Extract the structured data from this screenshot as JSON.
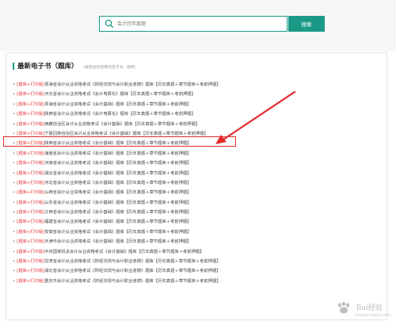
{
  "search": {
    "placeholder": "会计历年真题",
    "button_label": "搜索"
  },
  "section": {
    "title": "最新电子书（题库）",
    "hint": "（搜索查找您要的电子书、题库）"
  },
  "bullet": "•",
  "items": [
    {
      "tag": "[题库+打印版]",
      "name": "青海省会计从业资格考试《财经法规与会计职业道德》题库【历年真题＋章节题库＋考前押题】"
    },
    {
      "tag": "[题库+打印版]",
      "name": "河北省会计从业资格考试《会计电算化》题库【历年真题＋章节题库＋考前押题】"
    },
    {
      "tag": "[题库+打印版]",
      "name": "青海省会计从业资格考试《会计基础》题库【历年真题＋章节题库＋考前押题】"
    },
    {
      "tag": "[题库+打印版]",
      "name": "陕西省会计从业资格考试《会计电算化》题库【历年真题＋章节题库＋考前押题】"
    },
    {
      "tag": "[题库+打印版]",
      "name": "西藏自治区会计从业资格考试《会计基础》题库【历年真题＋章节题库＋考前押题】"
    },
    {
      "tag": "[题库+打印版]",
      "name": "宁夏回族自治区会计从业资格考试《会计基础》题库【历年真题＋章节题库＋考前押题】"
    },
    {
      "tag": "[题库+打印版]",
      "name": "陕西省会计从业资格考试《会计基础》题库【历年真题＋章节题库＋考前押题】"
    },
    {
      "tag": "[题库+打印版]",
      "name": "海南省会计从业资格考试《会计基础》题库【历年真题＋章节题库＋考前押题】"
    },
    {
      "tag": "[题库+打印版]",
      "name": "河南省会计从业资格考试《会计基础》题库【历年真题＋章节题库＋考前押题】"
    },
    {
      "tag": "[题库+打印版]",
      "name": "湖北省会计从业资格考试《会计基础》题库【历年真题＋章节题库＋考前押题】"
    },
    {
      "tag": "[题库+打印版]",
      "name": "河北省会计从业资格考试《会计基础》题库【历年真题＋章节题库＋考前押题】"
    },
    {
      "tag": "[题库+打印版]",
      "name": "山西省会计从业资格考试《会计基础》题库【历年真题＋章节题库＋考前押题】"
    },
    {
      "tag": "[题库+打印版]",
      "name": "山东省会计从业资格考试《会计基础》题库【历年真题＋章节题库＋考前押题】"
    },
    {
      "tag": "[题库+打印版]",
      "name": "江西省会计从业资格考试《会计基础》题库【历年真题＋章节题库＋考前押题】"
    },
    {
      "tag": "[题库+打印版]",
      "name": "福建省会计从业资格考试《会计基础》题库【历年真题＋章节题库＋考前押题】"
    },
    {
      "tag": "[题库+打印版]",
      "name": "安徽省会计从业资格考试《会计基础》题库【历年真题＋章节题库＋考前押题】"
    },
    {
      "tag": "[题库+打印版]",
      "name": "天津市会计从业资格考试《会计基础》题库【历年真题＋章节题库＋考前押题】"
    },
    {
      "tag": "[题库+打印版]",
      "name": "中央国家机关会计从业资格考试《会计基础》题库【历年真题＋章节题库＋考前押题】"
    },
    {
      "tag": "[题库+打印版]",
      "name": "甘肃省会计从业资格考试《财经法规与会计职业道德》题库【历年真题＋章节题库＋考前押题】"
    },
    {
      "tag": "[题库+打印版]",
      "name": "湖北省会计从业资格考试《财经法规与会计职业道德》题库【历年真题＋章节题库＋考前押题】"
    },
    {
      "tag": "[题库+打印版]",
      "name": "重庆市会计从业资格考试《财经法规与会计职业道德》题库【历年真题＋章节题库＋考前押题】"
    }
  ],
  "highlighted_index": 6,
  "watermark": {
    "text": "Bai经验",
    "sub": "jingyan.baidu.com"
  },
  "colors": {
    "accent": "#1a9a86",
    "tag": "#e4393c",
    "highlight": "#e32b2b"
  }
}
